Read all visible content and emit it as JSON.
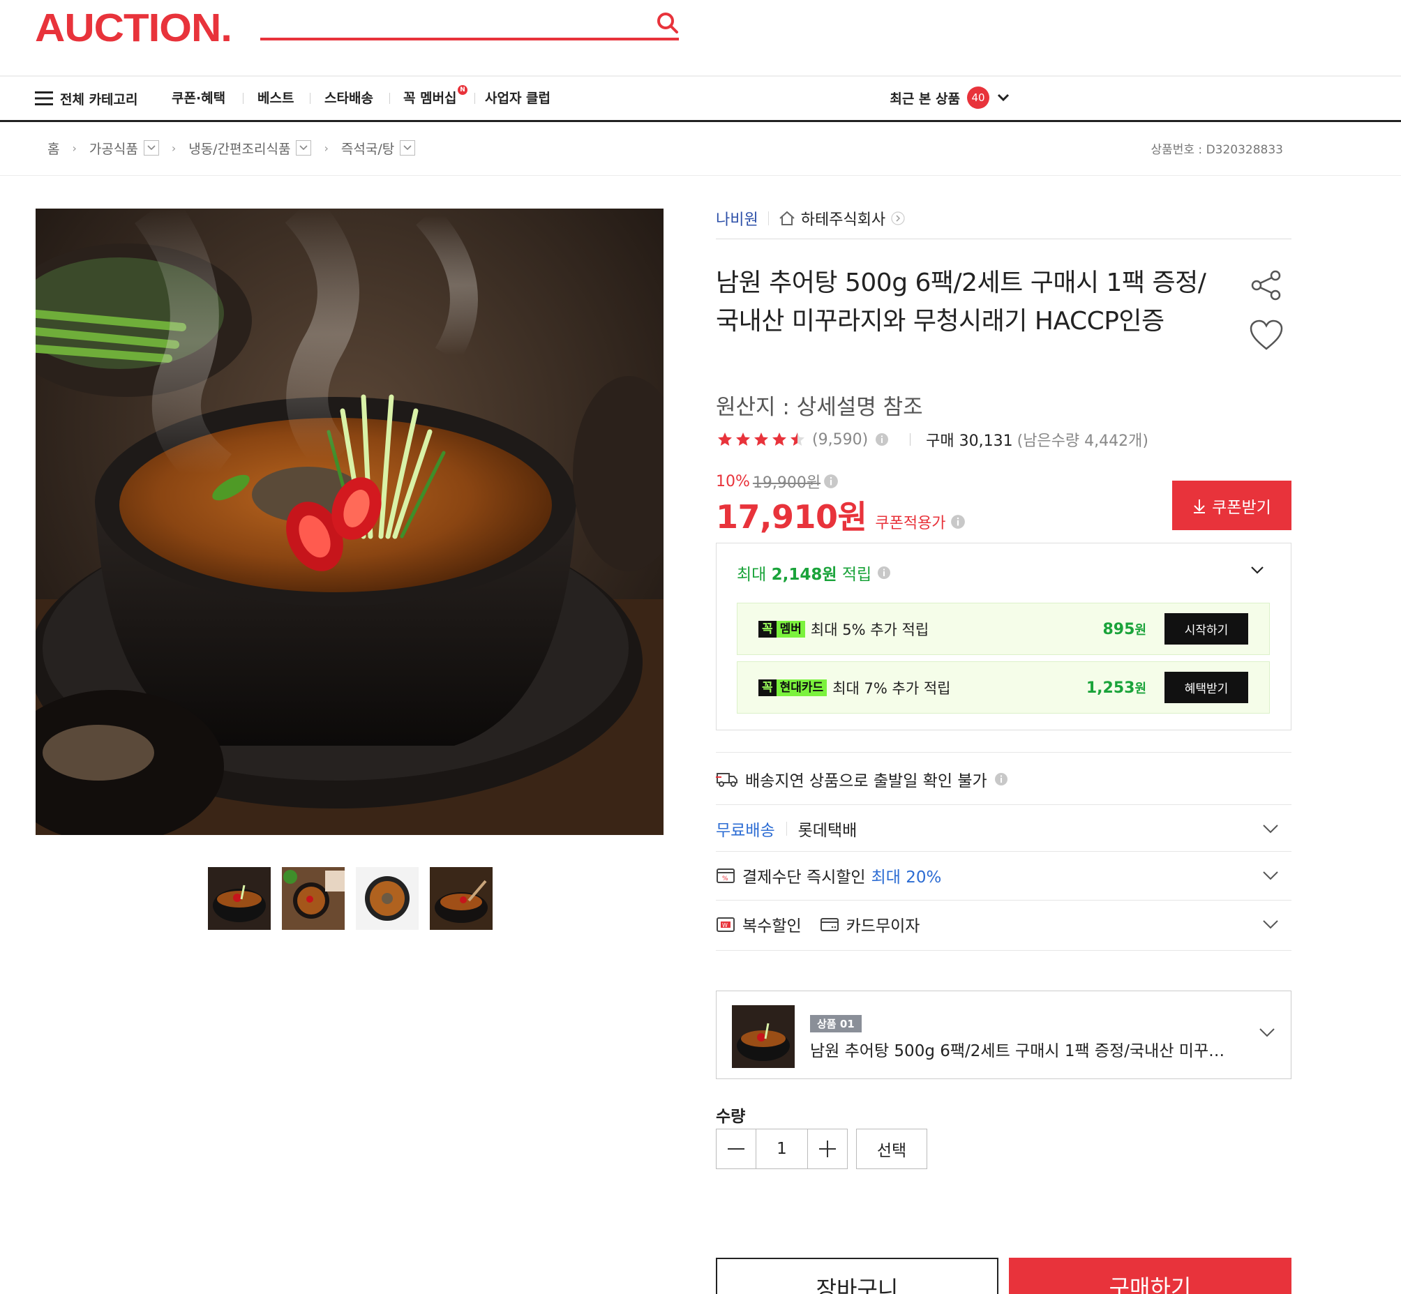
{
  "header": {
    "logo": "AUCTION.",
    "search_placeholder": ""
  },
  "nav": {
    "all_categories": "전체 카테고리",
    "items": [
      "쿠폰·혜택",
      "베스트",
      "스타배송",
      "꼭 멤버십",
      "사업자 클럽"
    ],
    "membership_badge": "N",
    "recent_label": "최근 본 상품",
    "recent_count": "40"
  },
  "breadcrumb": {
    "home": "홈",
    "levels": [
      "가공식품",
      "냉동/간편조리식품",
      "즉석국/탕"
    ],
    "product_no": "상품번호 : D320328833"
  },
  "product": {
    "brand": "나비원",
    "store": "하테주식회사",
    "title": "남원 추어탕 500g 6팩/2세트 구매시 1팩 증정/국내산 미꾸라지와 무청시래기 HACCP인증",
    "origin": "원산지 : 상세설명 참조",
    "rating": 4.5,
    "review_count": "(9,590)",
    "purchase": "구매 30,131",
    "remaining": "(남은수량 4,442개)",
    "discount_pct": "10%",
    "original_price": "19,900원",
    "price": "17,910원",
    "price_label": "쿠폰적용가",
    "coupon_button": "쿠폰받기"
  },
  "rewards": {
    "prefix": "최대 ",
    "amount": "2,148원",
    "suffix": " 적립",
    "rows": [
      {
        "tag1": "꼭",
        "tag2": "멤버",
        "text": "최대 5% 추가 적립",
        "amount": "895",
        "unit": "원",
        "button": "시작하기"
      },
      {
        "tag1": "꼭",
        "tag2": "현대카드",
        "text": "최대 7% 추가 적립",
        "amount": "1,253",
        "unit": "원",
        "button": "혜택받기"
      }
    ]
  },
  "shipping": {
    "notice": "배송지연 상품으로 출발일 확인 불가",
    "free": "무료배송",
    "courier": "롯데택배",
    "payment_label": "결제수단 즉시할인",
    "payment_highlight": "최대 20%",
    "multi_discount": "복수할인",
    "card_installment": "카드무이자"
  },
  "option": {
    "tag": "상품 01",
    "name": "남원 추어탕 500g 6팩/2세트 구매시 1팩 증정/국내산 미꾸라지..."
  },
  "quantity": {
    "label": "수량",
    "value": "1",
    "select": "선택"
  },
  "actions": {
    "cart": "장바구니",
    "buy": "구매하기"
  },
  "colors": {
    "brand_red": "#e8333b",
    "reward_green": "#1aa33a",
    "link_blue": "#2c6cd3"
  }
}
